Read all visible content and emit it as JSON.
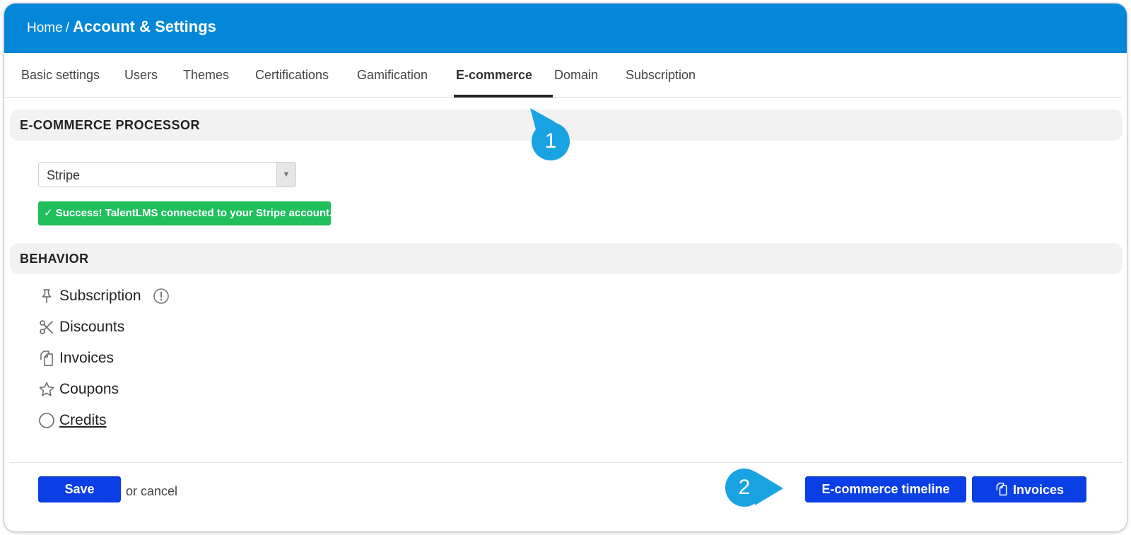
{
  "header": {
    "breadcrumb_home": "Home",
    "breadcrumb_separator": "/",
    "title": "Account & Settings",
    "bg_color": "#0487d8"
  },
  "tabs": [
    {
      "label": "Basic settings"
    },
    {
      "label": "Users"
    },
    {
      "label": "Themes"
    },
    {
      "label": "Certifications"
    },
    {
      "label": "Gamification"
    },
    {
      "label": "E-commerce",
      "active": true
    },
    {
      "label": "Domain"
    },
    {
      "label": "Subscription"
    }
  ],
  "processor": {
    "heading": "E-COMMERCE PROCESSOR",
    "selected": "Stripe",
    "success_message": "✓ Success! TalentLMS connected to your Stripe account.",
    "success_color": "#1fbf5c"
  },
  "behavior": {
    "heading": "BEHAVIOR",
    "items": [
      {
        "label": "Subscription",
        "icon": "pin-icon"
      },
      {
        "label": "Discounts",
        "icon": "scissors-icon"
      },
      {
        "label": "Invoices",
        "icon": "copy-icon"
      },
      {
        "label": "Coupons",
        "icon": "star-icon"
      },
      {
        "label": "Credits",
        "icon": "circle-icon"
      }
    ]
  },
  "footer": {
    "save_label": "Save",
    "cancel_text": "or cancel",
    "timeline_label": "E-commerce timeline",
    "invoices_label": "Invoices",
    "button_color": "#0a3fe6"
  },
  "callouts": [
    "1",
    "2"
  ]
}
